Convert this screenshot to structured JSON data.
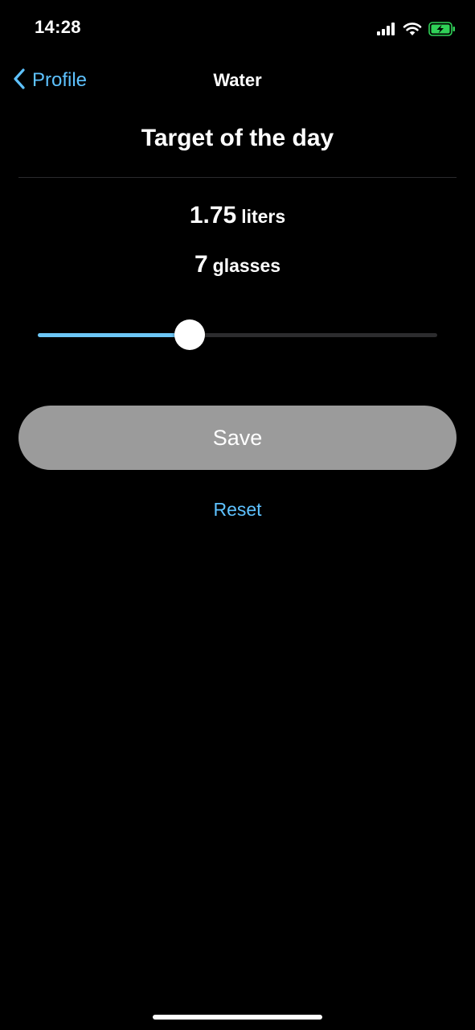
{
  "status_bar": {
    "time": "14:28",
    "icons": [
      "cellular-signal-icon",
      "wifi-icon",
      "battery-charging-icon"
    ],
    "battery_color": "#30d158"
  },
  "nav": {
    "back_label": "Profile",
    "title": "Water",
    "back_icon": "chevron-left-icon"
  },
  "main": {
    "title": "Target of the day",
    "liters_value": "1.75",
    "liters_unit": "liters",
    "glasses_value": "7",
    "glasses_unit": "glasses",
    "slider": {
      "fraction": 0.38
    },
    "save_label": "Save",
    "reset_label": "Reset"
  },
  "colors": {
    "accent": "#5ec2ff",
    "slider_fill": "#6cc6f5",
    "save_button_bg": "#9b9b9b",
    "background": "#000000"
  }
}
